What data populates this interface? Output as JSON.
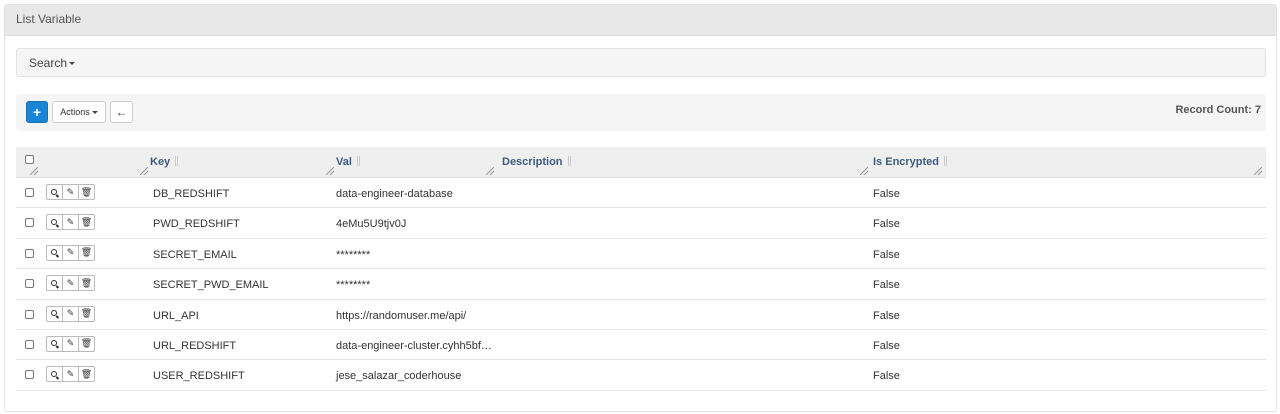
{
  "panel": {
    "title": "List Variable"
  },
  "search": {
    "label": "Search"
  },
  "toolbar": {
    "add_label": "+",
    "actions_label": "Actions",
    "back_label": "←",
    "record_count": "Record Count: 7"
  },
  "table": {
    "columns": [
      "Key",
      "Val",
      "Description",
      "Is Encrypted"
    ],
    "rows": [
      {
        "key": "DB_REDSHIFT",
        "val": "data-engineer-database",
        "description": "",
        "is_encrypted": "False"
      },
      {
        "key": "PWD_REDSHIFT",
        "val": "4eMu5U9tjv0J",
        "description": "",
        "is_encrypted": "False"
      },
      {
        "key": "SECRET_EMAIL",
        "val": "********",
        "description": "",
        "is_encrypted": "False"
      },
      {
        "key": "SECRET_PWD_EMAIL",
        "val": "********",
        "description": "",
        "is_encrypted": "False"
      },
      {
        "key": "URL_API",
        "val": "https://randomuser.me/api/",
        "description": "",
        "is_encrypted": "False"
      },
      {
        "key": "URL_REDSHIFT",
        "val": "data-engineer-cluster.cyhh5bf…",
        "description": "",
        "is_encrypted": "False"
      },
      {
        "key": "USER_REDSHIFT",
        "val": "jese_salazar_coderhouse",
        "description": "",
        "is_encrypted": "False"
      }
    ]
  },
  "icons": {
    "view": "search-icon",
    "edit": "edit-icon",
    "delete": "trash-icon"
  },
  "colors": {
    "primary": "#1a84d6",
    "header_text": "#3e5c7d"
  }
}
